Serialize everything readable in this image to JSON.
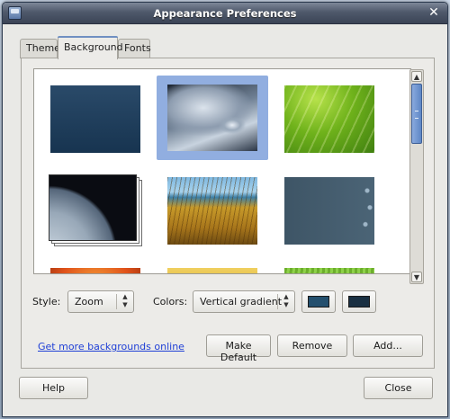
{
  "window": {
    "title": "Appearance Preferences",
    "close_glyph": "✕"
  },
  "tabs": [
    {
      "label": "Theme",
      "active": false
    },
    {
      "label": "Background",
      "active": true
    },
    {
      "label": "Fonts",
      "active": false
    }
  ],
  "gallery": {
    "wallpapers": [
      {
        "name": "navy-solid",
        "selected": false
      },
      {
        "name": "water-drop",
        "selected": true
      },
      {
        "name": "green-leaf",
        "selected": false
      },
      {
        "name": "earth-horizon-slideshow",
        "selected": false
      },
      {
        "name": "grass-field",
        "selected": false
      },
      {
        "name": "slate-bubbles",
        "selected": false
      },
      {
        "name": "orange-flower",
        "selected": false
      },
      {
        "name": "yellow-flower",
        "selected": false
      },
      {
        "name": "lime-grass",
        "selected": false
      }
    ],
    "scroll_up_glyph": "▲",
    "scroll_down_glyph": "▼"
  },
  "options": {
    "style_label": "Style:",
    "style_value": "Zoom",
    "colors_label": "Colors:",
    "colors_value": "Vertical gradient",
    "primary_color": "#24506e",
    "secondary_color": "#1a3042",
    "combo_arrows": "▲\n▼"
  },
  "actions": {
    "more_link": "Get more backgrounds online",
    "make_default": "Make Default",
    "remove": "Remove",
    "add": "Add..."
  },
  "footer": {
    "help": "Help",
    "close": "Close"
  },
  "colors": {
    "selection": "#91aee0",
    "link": "#1f3fd6",
    "titlebar": "#4f596b"
  }
}
